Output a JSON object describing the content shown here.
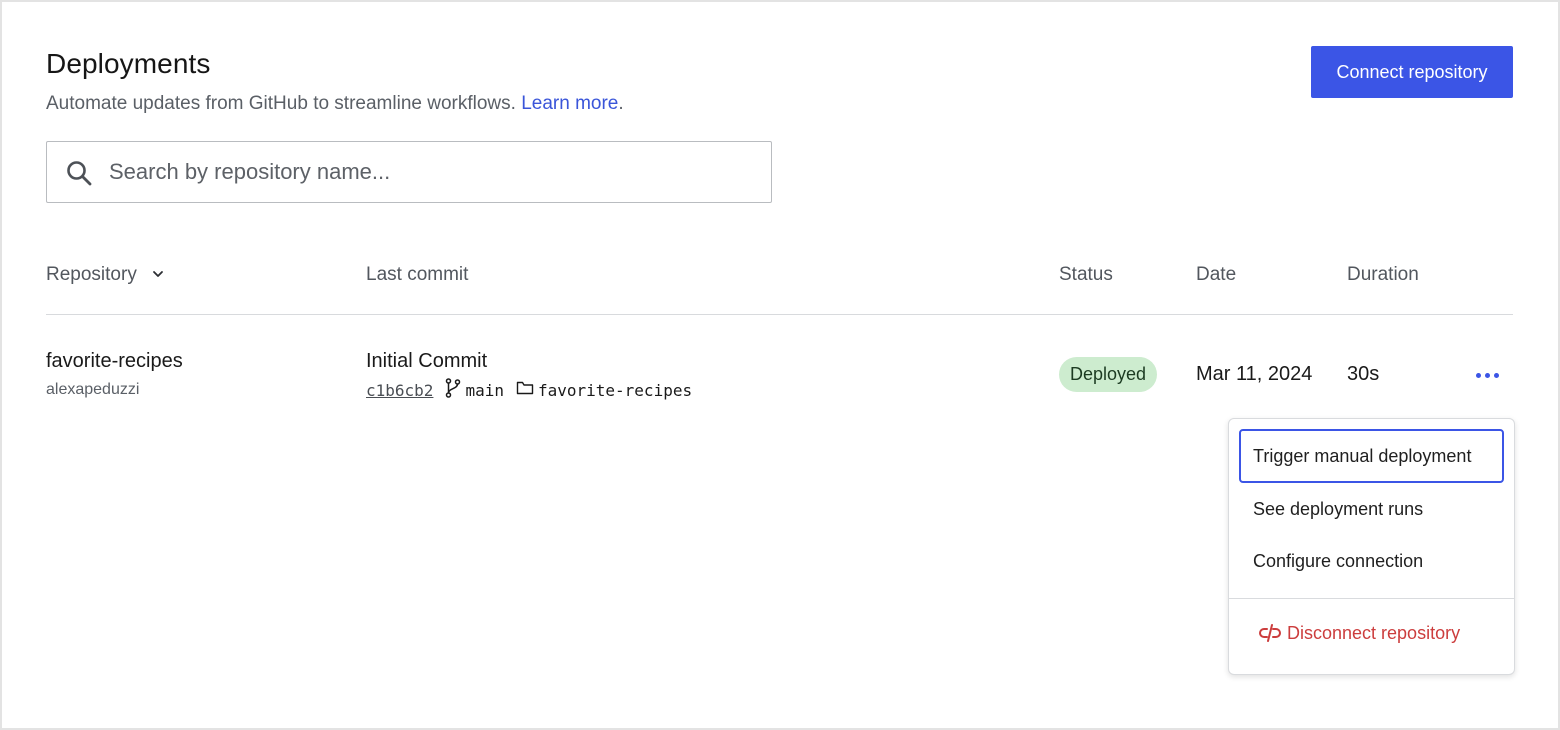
{
  "header": {
    "title": "Deployments",
    "subtitle": "Automate updates from GitHub to streamline workflows.",
    "learn_more": "Learn more",
    "subtitle_end": ".",
    "connect_button": "Connect repository"
  },
  "search": {
    "placeholder": "Search by repository name...",
    "value": "",
    "icon": "search-icon"
  },
  "table": {
    "columns": {
      "repository": "Repository",
      "last_commit": "Last commit",
      "status": "Status",
      "date": "Date",
      "duration": "Duration"
    },
    "rows": [
      {
        "repo_name": "favorite-recipes",
        "repo_owner": "alexapeduzzi",
        "commit_title": "Initial Commit",
        "commit_hash": "c1b6cb2",
        "branch": "main",
        "folder": "favorite-recipes",
        "status": "Deployed",
        "date": "Mar 11, 2024",
        "duration": "30s"
      }
    ]
  },
  "menu": {
    "items": [
      "Trigger manual deployment",
      "See deployment runs",
      "Configure connection"
    ],
    "danger_item": "Disconnect repository"
  },
  "colors": {
    "accent": "#3b55e6",
    "link": "#3a55d9",
    "status_deployed_bg": "#cdeccf",
    "danger": "#cc3d3d"
  }
}
